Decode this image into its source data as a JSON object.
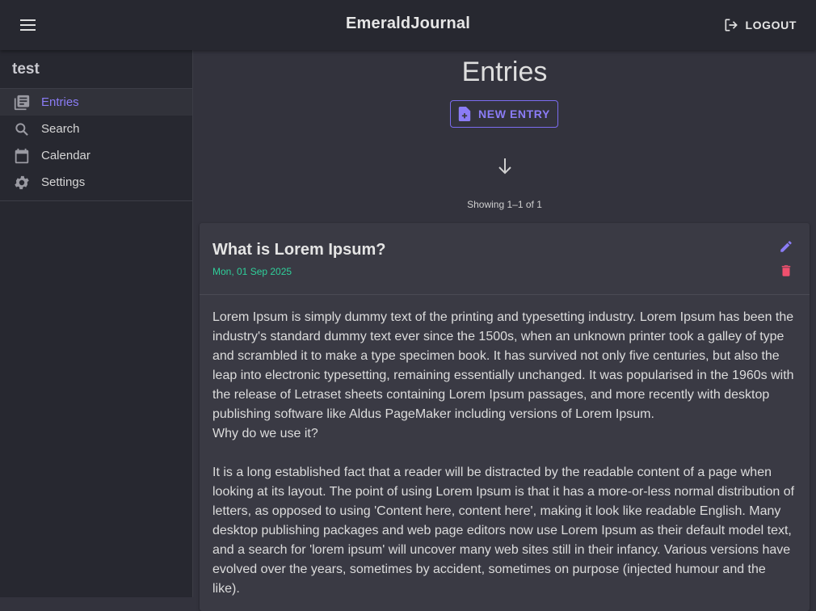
{
  "header": {
    "app_title": "EmeraldJournal",
    "logout_label": "LOGOUT",
    "menu_icon": "hamburger-menu-icon",
    "logout_icon": "logout-icon"
  },
  "sidebar": {
    "user_name": "test",
    "items": [
      {
        "label": "Entries",
        "icon": "entries-icon",
        "active": true
      },
      {
        "label": "Search",
        "icon": "search-icon",
        "active": false
      },
      {
        "label": "Calendar",
        "icon": "calendar-icon",
        "active": false
      },
      {
        "label": "Settings",
        "icon": "gear-icon",
        "active": false
      }
    ]
  },
  "main": {
    "title": "Entries",
    "new_entry_label": "NEW ENTRY",
    "pagination_text": "Showing 1–1 of 1",
    "entry": {
      "title": "What is Lorem Ipsum?",
      "date": "Mon, 01 Sep 2025",
      "body": "Lorem Ipsum is simply dummy text of the printing and typesetting industry. Lorem Ipsum has been the industry's standard dummy text ever since the 1500s, when an unknown printer took a galley of type and scrambled it to make a type specimen book. It has survived not only five centuries, but also the leap into electronic typesetting, remaining essentially unchanged. It was popularised in the 1960s with the release of Letraset sheets containing Lorem Ipsum passages, and more recently with desktop publishing software like Aldus PageMaker including versions of Lorem Ipsum.\nWhy do we use it?\n\nIt is a long established fact that a reader will be distracted by the readable content of a page when looking at its layout. The point of using Lorem Ipsum is that it has a more-or-less normal distribution of letters, as opposed to using 'Content here, content here', making it look like readable English. Many desktop publishing packages and web page editors now use Lorem Ipsum as their default model text, and a search for 'lorem ipsum' will uncover many web sites still in their infancy. Various versions have evolved over the years, sometimes by accident, sometimes on purpose (injected humour and the like)."
    }
  },
  "colors": {
    "accent": "#8b7cf6",
    "date": "#2fcf9a",
    "delete": "#f0506e",
    "edit": "#8b7cf6"
  }
}
